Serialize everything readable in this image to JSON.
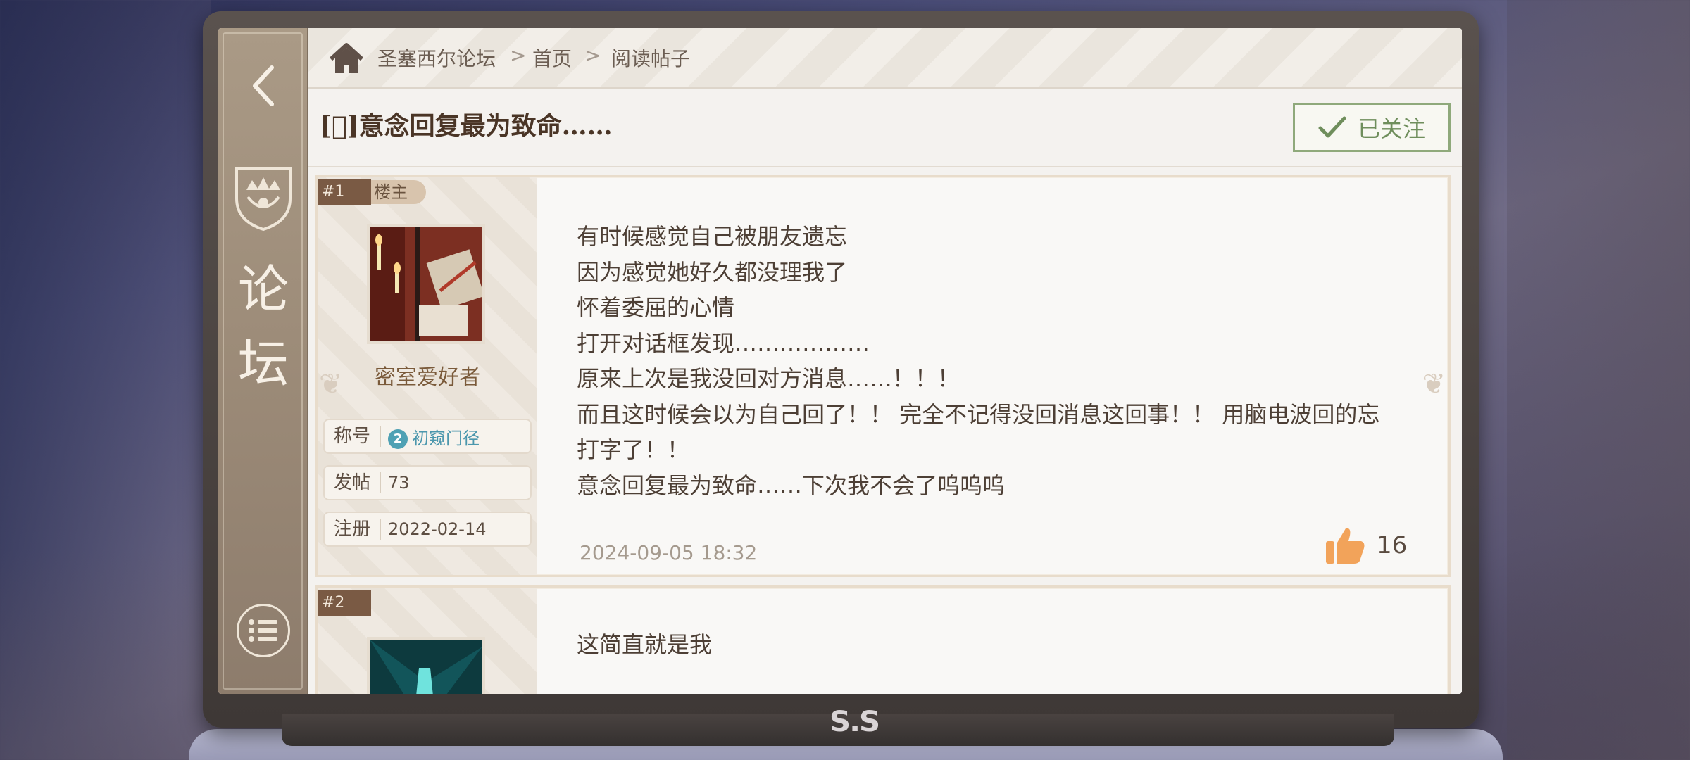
{
  "breadcrumb": {
    "forum": "圣塞西尔论坛",
    "sep": ">",
    "home": "首页",
    "current": "阅读帖子"
  },
  "sidebar": {
    "title_line1": "论",
    "title_line2": "坛"
  },
  "post_title": "[ﾞ]意念回复最为致命……",
  "follow_button": {
    "label": "已关注"
  },
  "posts": [
    {
      "floor": "#1",
      "tag": "楼主",
      "username": "密室爱好者",
      "rank_label": "称号",
      "rank_level": "2",
      "rank_value": "初窥门径",
      "posts_label": "发帖",
      "posts_value": "73",
      "register_label": "注册",
      "register_value": "2022-02-14",
      "lines": [
        "有时候感觉自己被朋友遗忘",
        "因为感觉她好久都没理我了",
        "怀着委屈的心情",
        "打开对话框发现………………",
        "原来上次是我没回对方消息……！！！",
        "而且这时候会以为自己回了！！ 完全不记得没回消息这回事！！ 用脑电波回的忘",
        "打字了！！",
        "意念回复最为致命……下次我不会了呜呜呜"
      ],
      "timestamp": "2024-09-05  18:32",
      "likes": "16"
    },
    {
      "floor": "#2",
      "lines": [
        "这简直就是我"
      ]
    }
  ],
  "device_logo": "S.S",
  "colors": {
    "accent_green": "#8fa97b",
    "floor_brown": "#7a5a44",
    "like_orange": "#f2a35a"
  },
  "icons": [
    "back-arrow-icon",
    "forum-crest-icon",
    "menu-list-icon",
    "home-icon",
    "chevron-right-icon",
    "check-icon",
    "thumbs-up-icon"
  ]
}
